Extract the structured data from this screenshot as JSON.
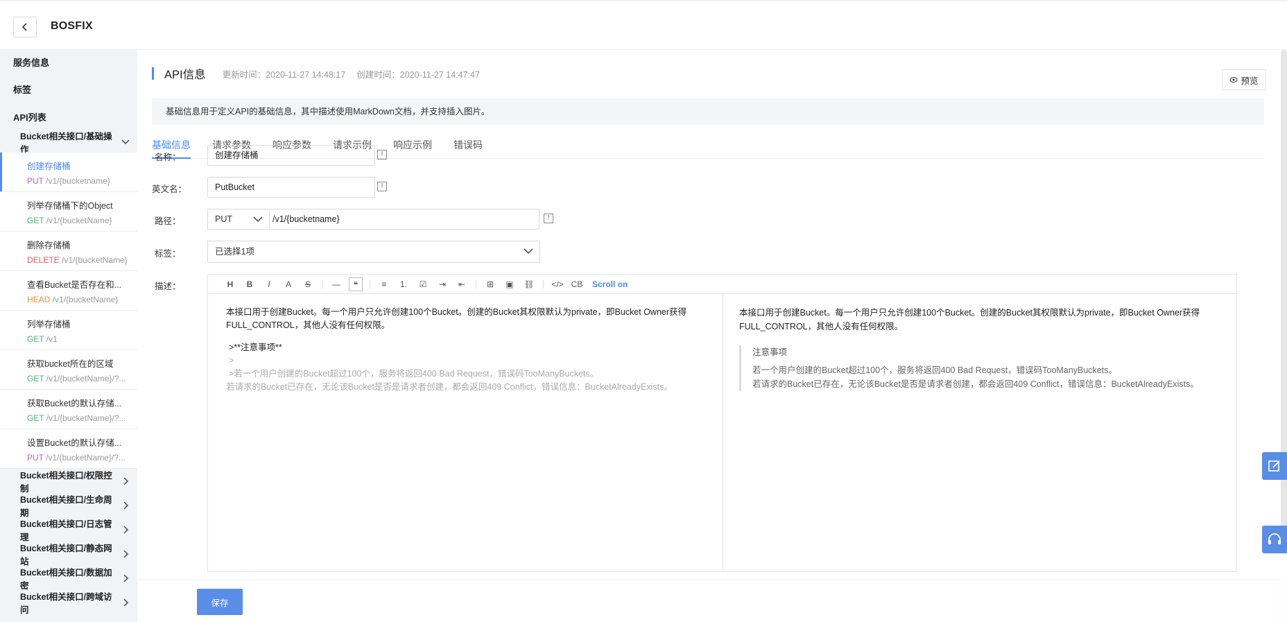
{
  "app": {
    "title": "BOSFIX"
  },
  "sidebar": {
    "top_links": [
      "服务信息",
      "标签",
      "API列表"
    ],
    "expanded_group": "Bucket相关接口/基础操作",
    "apis": [
      {
        "name": "创建存储桶",
        "method": "PUT",
        "path": "/v1/{bucketname}",
        "method_color": "#b15ee0"
      },
      {
        "name": "列举存储桶下的Object",
        "method": "GET",
        "path": "/v1/{bucketName}",
        "method_color": "#46b574"
      },
      {
        "name": "删除存储桶",
        "method": "DELETE",
        "path": "/v1/{bucketName}",
        "method_color": "#e35b5b"
      },
      {
        "name": "查看Bucket是否存在和...",
        "method": "HEAD",
        "path": "/v1/{bucketName}",
        "method_color": "#e8913a"
      },
      {
        "name": "列举存储桶",
        "method": "GET",
        "path": "/v1",
        "method_color": "#46b574"
      },
      {
        "name": "获取bucket所在的区域",
        "method": "GET",
        "path": "/v1/{bucketName}/?...",
        "method_color": "#46b574"
      },
      {
        "name": "获取Bucket的默认存储...",
        "method": "GET",
        "path": "/v1/{bucketName}/?...",
        "method_color": "#46b574"
      },
      {
        "name": "设置Bucket的默认存储...",
        "method": "PUT",
        "path": "/v1/{bucketName}/?...",
        "method_color": "#b15ee0"
      }
    ],
    "collapsed_groups": [
      "Bucket相关接口/权限控制",
      "Bucket相关接口/生命周期",
      "Bucket相关接口/日志管理",
      "Bucket相关接口/静态网站",
      "Bucket相关接口/数据加密",
      "Bucket相关接口/跨域访问"
    ]
  },
  "section": {
    "title": "API信息",
    "updated": "更新时间：2020-11-27 14:48:17",
    "created": "创建时间：2020-11-27 14:47:47",
    "preview_label": "预览",
    "info": "基础信息用于定义API的基础信息，其中描述使用MarkDown文档，并支持插入图片。"
  },
  "tabs": [
    "基础信息",
    "请求参数",
    "响应参数",
    "请求示例",
    "响应示例",
    "错误码"
  ],
  "form": {
    "name_label": "名称：",
    "name_value": "创建存储桶",
    "en_label": "英文名：",
    "en_value": "PutBucket",
    "path_label": "路径：",
    "method_value": "PUT",
    "path_value": "/v1/{bucketname}",
    "tag_label": "标签：",
    "tag_value": "已选择1项",
    "desc_label": "描述："
  },
  "editor": {
    "toolbar": [
      "H",
      "B",
      "I",
      "A",
      "S",
      "—",
      "❝",
      "≡",
      "1.",
      "☑",
      "⇥",
      "⇤",
      "⊞",
      "▣",
      "⛓",
      "</>",
      "CB"
    ],
    "scroll_label": "Scroll on",
    "source_lines": [
      "本接口用于创建Bucket。每一个用户只允许创建100个Bucket。创建的Bucket其权限默认为private，即Bucket Owner获得FULL_CONTROL，其他人没有任何权限。",
      ">**注意事项**",
      ">",
      ">若一个用户创建的Bucket超过100个，服务将返回400 Bad Request，错误码TooManyBuckets。",
      "若请求的Bucket已存在，无论该Bucket是否是请求者创建，都会返回409 Conflict，错误信息：BucketAlreadyExists。"
    ],
    "preview_para": "本接口用于创建Bucket。每一个用户只允许创建100个Bucket。创建的Bucket其权限默认为private，即Bucket Owner获得FULL_CONTROL，其他人没有任何权限。",
    "preview_quote_title": "注意事项",
    "preview_quote_lines": [
      "若一个用户创建的Bucket超过100个，服务将返回400 Bad Request，错误码TooManyBuckets。",
      "若请求的Bucket已存在，无论该Bucket是否是请求者创建，都会返回409 Conflict，错误信息：BucketAlreadyExists。"
    ]
  },
  "footer": {
    "save_label": "保存"
  },
  "colors": {
    "accent": "#4a8af4",
    "save": "#5a8ee6"
  }
}
